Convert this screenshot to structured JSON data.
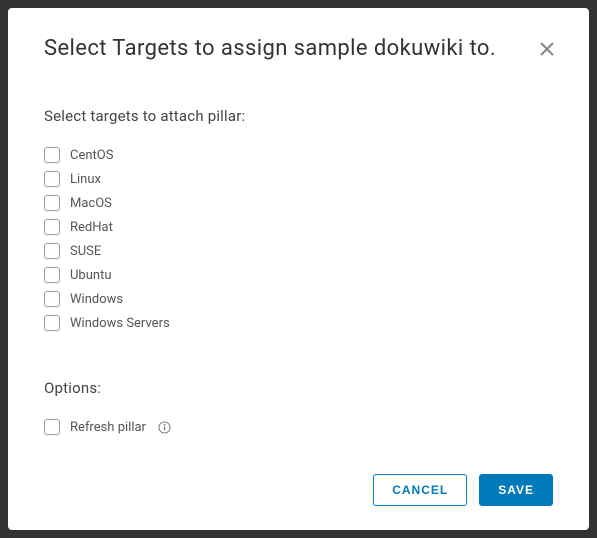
{
  "modal": {
    "title": "Select Targets to assign sample dokuwiki to.",
    "section_label": "Select targets to attach pillar:",
    "targets": [
      {
        "label": "CentOS"
      },
      {
        "label": "Linux"
      },
      {
        "label": "MacOS"
      },
      {
        "label": "RedHat"
      },
      {
        "label": "SUSE"
      },
      {
        "label": "Ubuntu"
      },
      {
        "label": "Windows"
      },
      {
        "label": "Windows Servers"
      }
    ],
    "options_label": "Options:",
    "options": [
      {
        "label": "Refresh pillar",
        "has_info": true
      }
    ],
    "buttons": {
      "cancel": "CANCEL",
      "save": "SAVE"
    }
  }
}
